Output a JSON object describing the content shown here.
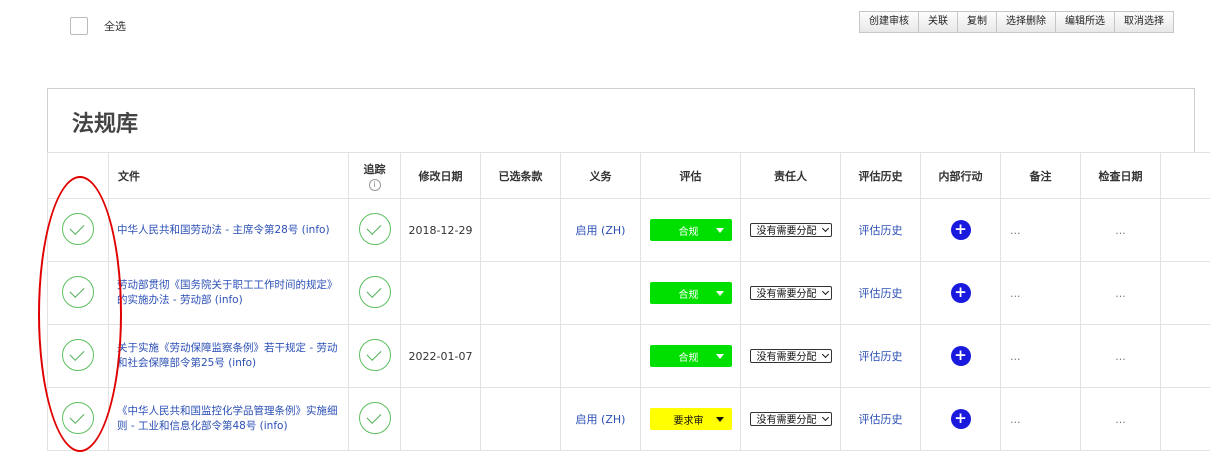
{
  "select_all": {
    "label": "全选"
  },
  "toolbar": {
    "buttons": [
      "创建审核",
      "关联",
      "复制",
      "选择删除",
      "编辑所选",
      "取消选择"
    ]
  },
  "panel": {
    "title": "法规库"
  },
  "table": {
    "headers": {
      "document": "文件",
      "tracking": "追踪",
      "tracking_info": "i",
      "modified_date": "修改日期",
      "selected_clauses": "已选条款",
      "obligation": "义务",
      "evaluation": "评估",
      "responsible": "责任人",
      "eval_history": "评估历史",
      "internal_action": "内部行动",
      "notes": "备注",
      "check_date": "检查日期"
    },
    "rows": [
      {
        "document": "中华人民共和国劳动法 - 主席令第28号 (info)",
        "modified_date": "2018-12-29",
        "selected_clauses": "",
        "obligation": "启用 (ZH)",
        "evaluation": "合规",
        "evaluation_color": "#00e000",
        "responsible": "没有需要分配",
        "eval_history": "评估历史",
        "action": "+",
        "notes": "...",
        "check_date": "..."
      },
      {
        "document": "劳动部贯彻《国务院关于职工工作时间的规定》的实施办法 - 劳动部 (info)",
        "modified_date": "",
        "selected_clauses": "",
        "obligation": "",
        "evaluation": "合规",
        "evaluation_color": "#00e000",
        "responsible": "没有需要分配",
        "eval_history": "评估历史",
        "action": "+",
        "notes": "...",
        "check_date": "..."
      },
      {
        "document": "关于实施《劳动保障监察条例》若干规定 - 劳动和社会保障部令第25号 (info)",
        "modified_date": "2022-01-07",
        "selected_clauses": "",
        "obligation": "",
        "evaluation": "合规",
        "evaluation_color": "#00e000",
        "responsible": "没有需要分配",
        "eval_history": "评估历史",
        "action": "+",
        "notes": "...",
        "check_date": "..."
      },
      {
        "document": "《中华人民共和国监控化学品管理条例》实施细则 - 工业和信息化部令第48号 (info)",
        "modified_date": "",
        "selected_clauses": "",
        "obligation": "启用 (ZH)",
        "evaluation": "要求审",
        "evaluation_color": "#ffff00",
        "responsible": "没有需要分配",
        "eval_history": "评估历史",
        "action": "+",
        "notes": "...",
        "check_date": "..."
      }
    ]
  },
  "colors": {
    "link": "#2b4fb5",
    "compliant": "#00e000",
    "review": "#ffff00",
    "track_border": "#3cb043",
    "action_button": "#1a1adf",
    "annotation": "#e00000"
  }
}
